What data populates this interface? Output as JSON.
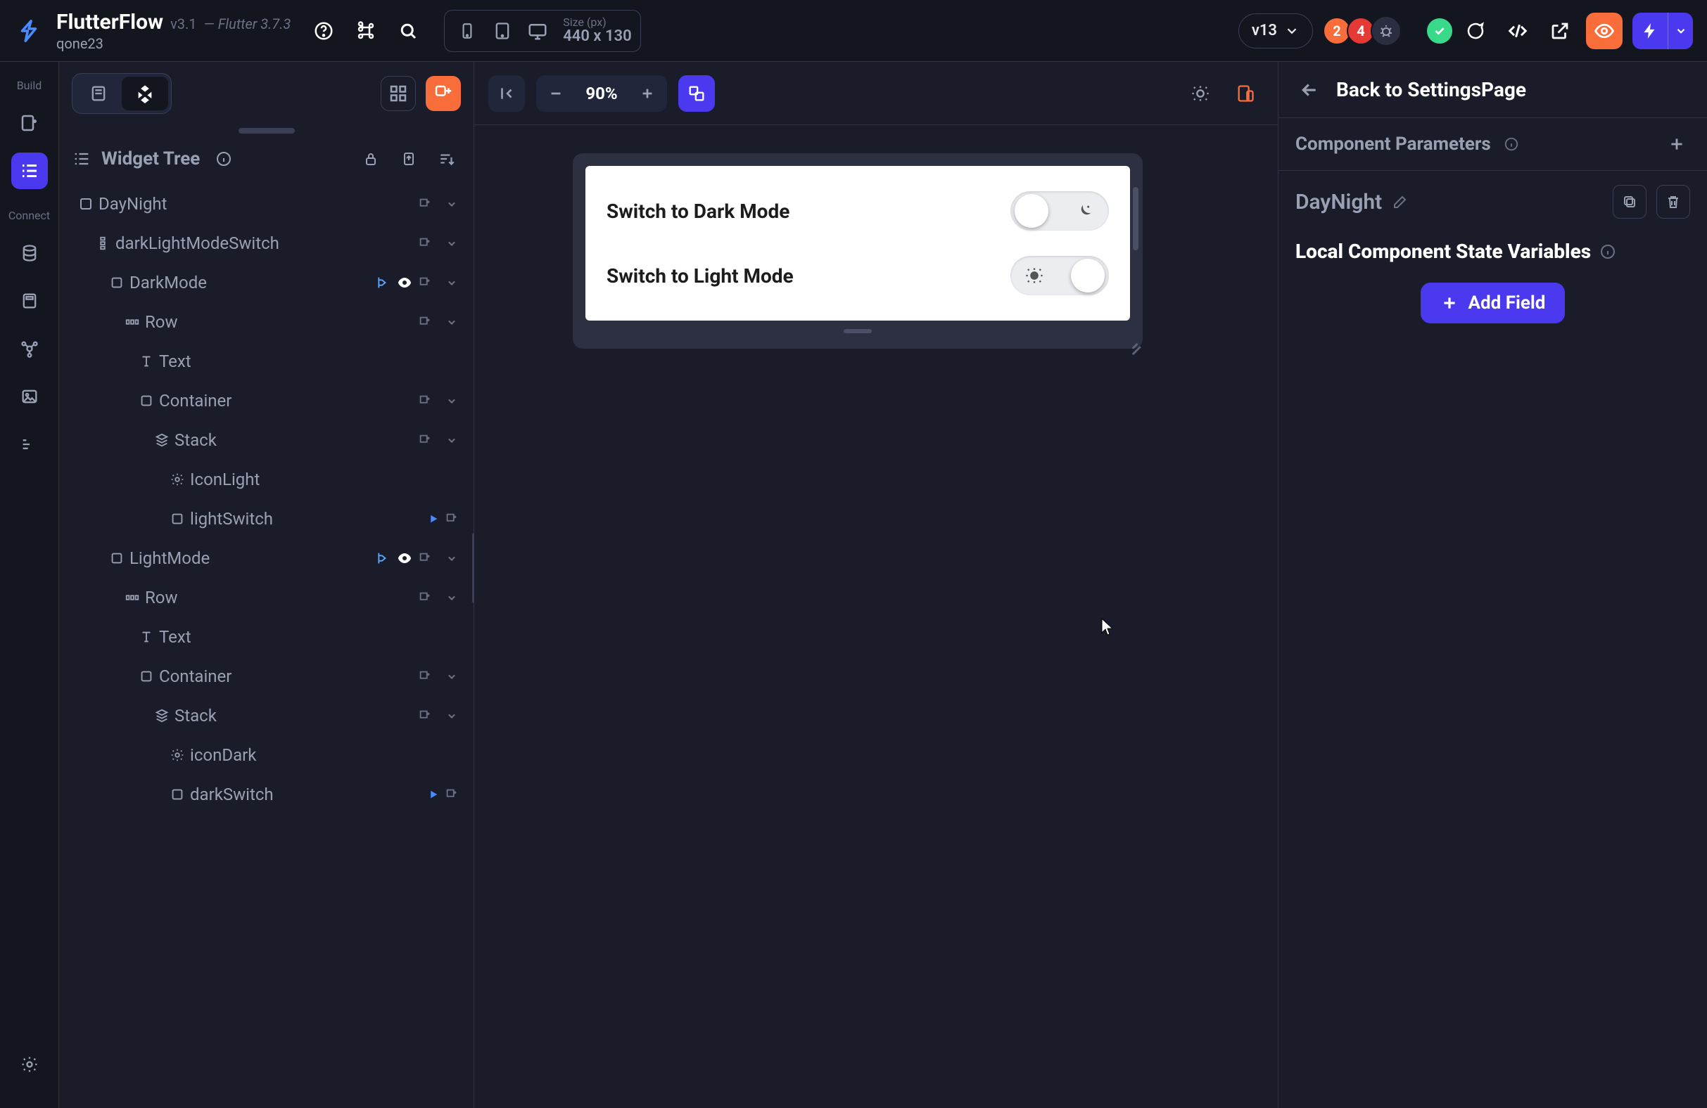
{
  "header": {
    "app_name": "FlutterFlow",
    "version": "v3.1",
    "flutter_version": "— Flutter 3.7.3",
    "user": "qone23",
    "size_label": "Size (px)",
    "size_value": "440 x 130",
    "project_version": "v13",
    "warning_count": "2",
    "error_count": "4"
  },
  "rail": {
    "build_label": "Build",
    "connect_label": "Connect"
  },
  "leftpanel": {
    "widget_tree_title": "Widget Tree"
  },
  "tree": {
    "day_night": "DayNight",
    "dark_light_switch": "darkLightModeSwitch",
    "dark_mode": "DarkMode",
    "row1": "Row",
    "text1": "Text",
    "container1": "Container",
    "stack1": "Stack",
    "icon_light": "IconLight",
    "light_switch": "lightSwitch",
    "light_mode": "LightMode",
    "row2": "Row",
    "text2": "Text",
    "container2": "Container",
    "stack2": "Stack",
    "icon_dark": "iconDark",
    "dark_switch": "darkSwitch"
  },
  "canvas": {
    "zoom": "90%",
    "switch_dark_label": "Switch to Dark Mode",
    "switch_light_label": "Switch to Light Mode"
  },
  "rightpanel": {
    "back_label": "Back to SettingsPage",
    "params_title": "Component Parameters",
    "component_name": "DayNight",
    "state_title": "Local Component State Variables",
    "add_field": "Add Field"
  }
}
